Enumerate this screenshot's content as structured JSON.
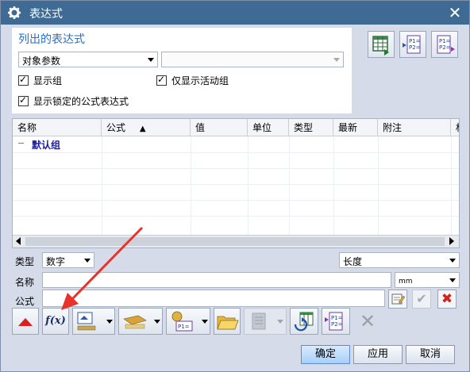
{
  "dialog": {
    "title": "表达式",
    "close_icon": "close-icon"
  },
  "list_section": {
    "title": "列出的表达式",
    "filter_select": "对象参数",
    "filter_value": "",
    "show_groups": {
      "label": "显示组",
      "checked": true
    },
    "only_active_group": {
      "label": "仅显示活动组",
      "checked": true
    },
    "show_locked": {
      "label": "显示锁定的公式表达式",
      "checked": true
    }
  },
  "table": {
    "columns": [
      "名称",
      "公式",
      "值",
      "单位",
      "类型",
      "最新",
      "附注",
      "权"
    ],
    "sort_indicator": "▲",
    "rows": [
      {
        "expander": "−",
        "name": "默认组"
      }
    ]
  },
  "editor": {
    "type_label": "类型",
    "type_value": "数字",
    "dimension_value": "长度",
    "name_label": "名称",
    "name_value": "",
    "unit_value": "mm",
    "formula_label": "公式",
    "formula_value": ""
  },
  "toolbar": {
    "fx_label": "f(x)"
  },
  "footer": {
    "ok_label": "确定",
    "apply_label": "应用",
    "cancel_label": "取消"
  },
  "colors": {
    "title_bar": "#3f6a94",
    "dialog_bg": "#d6dbe9",
    "section_title": "#2a6fc2",
    "group_text": "#1a1aa6",
    "annotation_arrow": "#e8322a"
  }
}
